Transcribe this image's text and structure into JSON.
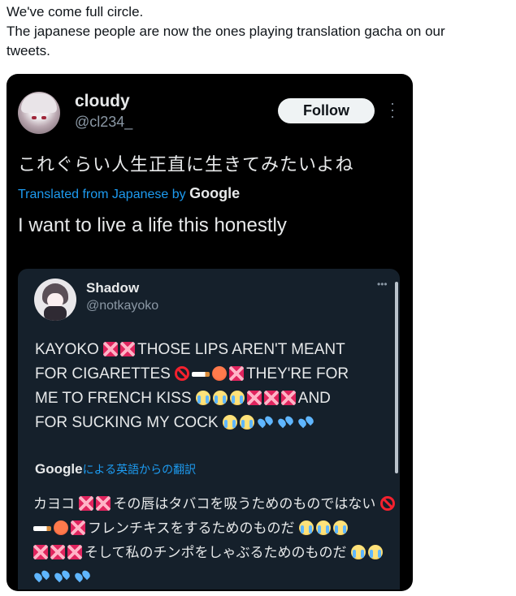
{
  "caption": {
    "line1": "We've come full circle.",
    "line2": "The japanese people are now the ones playing translation gacha on our",
    "line3": "tweets."
  },
  "outer_tweet": {
    "display_name": "cloudy",
    "handle": "@cl234_",
    "follow_label": "Follow",
    "text_jp": "これぐらい人生正直に生きてみたいよね",
    "translated_label": "Translated from Japanese by",
    "translator": "Google",
    "text_en": "I want to live a life this honestly"
  },
  "quoted_tweet": {
    "display_name": "Shadow",
    "handle": "@notkayoko",
    "lines": [
      {
        "segments": [
          {
            "t": "KAYOKO"
          },
          {
            "e": "anger"
          },
          {
            "e": "anger"
          },
          {
            "t": "THOSE LIPS AREN'T MEANT"
          }
        ]
      },
      {
        "segments": [
          {
            "t": "FOR CIGARETTES"
          },
          {
            "e": "nosign"
          },
          {
            "e": "cig"
          },
          {
            "e": "rage"
          },
          {
            "e": "anger"
          },
          {
            "t": "THEY'RE FOR"
          }
        ]
      },
      {
        "segments": [
          {
            "t": "ME TO FRENCH KISS"
          },
          {
            "e": "cry"
          },
          {
            "e": "cry"
          },
          {
            "e": "cry"
          },
          {
            "e": "anger"
          },
          {
            "e": "anger"
          },
          {
            "e": "anger"
          },
          {
            "t": "AND"
          }
        ]
      },
      {
        "segments": [
          {
            "t": "FOR SUCKING MY COCK"
          },
          {
            "e": "cry"
          },
          {
            "e": "cry"
          },
          {
            "e": "drops"
          },
          {
            "e": "drops"
          },
          {
            "e": "drops"
          }
        ]
      }
    ],
    "translator": "Google",
    "translated_label": "による英語からの翻訳",
    "jp_lines": [
      {
        "segments": [
          {
            "t": "カヨコ"
          },
          {
            "e": "anger"
          },
          {
            "e": "anger"
          },
          {
            "t": "その唇はタバコを吸うためのものではない"
          },
          {
            "e": "nosign"
          }
        ]
      },
      {
        "segments": [
          {
            "e": "cig"
          },
          {
            "e": "rage"
          },
          {
            "e": "anger"
          },
          {
            "t": "フレンチキスをするためのものだ"
          },
          {
            "e": "cry"
          },
          {
            "e": "cry"
          },
          {
            "e": "cry"
          }
        ]
      },
      {
        "segments": [
          {
            "e": "anger"
          },
          {
            "e": "anger"
          },
          {
            "e": "anger"
          },
          {
            "t": "そして私のチンポをしゃぶるためのものだ"
          },
          {
            "e": "cry"
          },
          {
            "e": "cry"
          }
        ]
      },
      {
        "segments": [
          {
            "e": "drops"
          },
          {
            "e": "drops"
          },
          {
            "e": "drops"
          }
        ]
      }
    ]
  },
  "emoji_names": {
    "anger": "anger-symbol-icon",
    "nosign": "prohibited-icon",
    "cig": "cigarette-icon",
    "rage": "angry-face-icon",
    "cry": "crying-face-icon",
    "drops": "sweat-droplets-icon"
  },
  "colors": {
    "link_blue": "#1d9bf0",
    "dark_bg": "#000000",
    "quote_bg": "#15202b",
    "text_light": "#e7e9ea",
    "muted": "#8b98a5"
  }
}
